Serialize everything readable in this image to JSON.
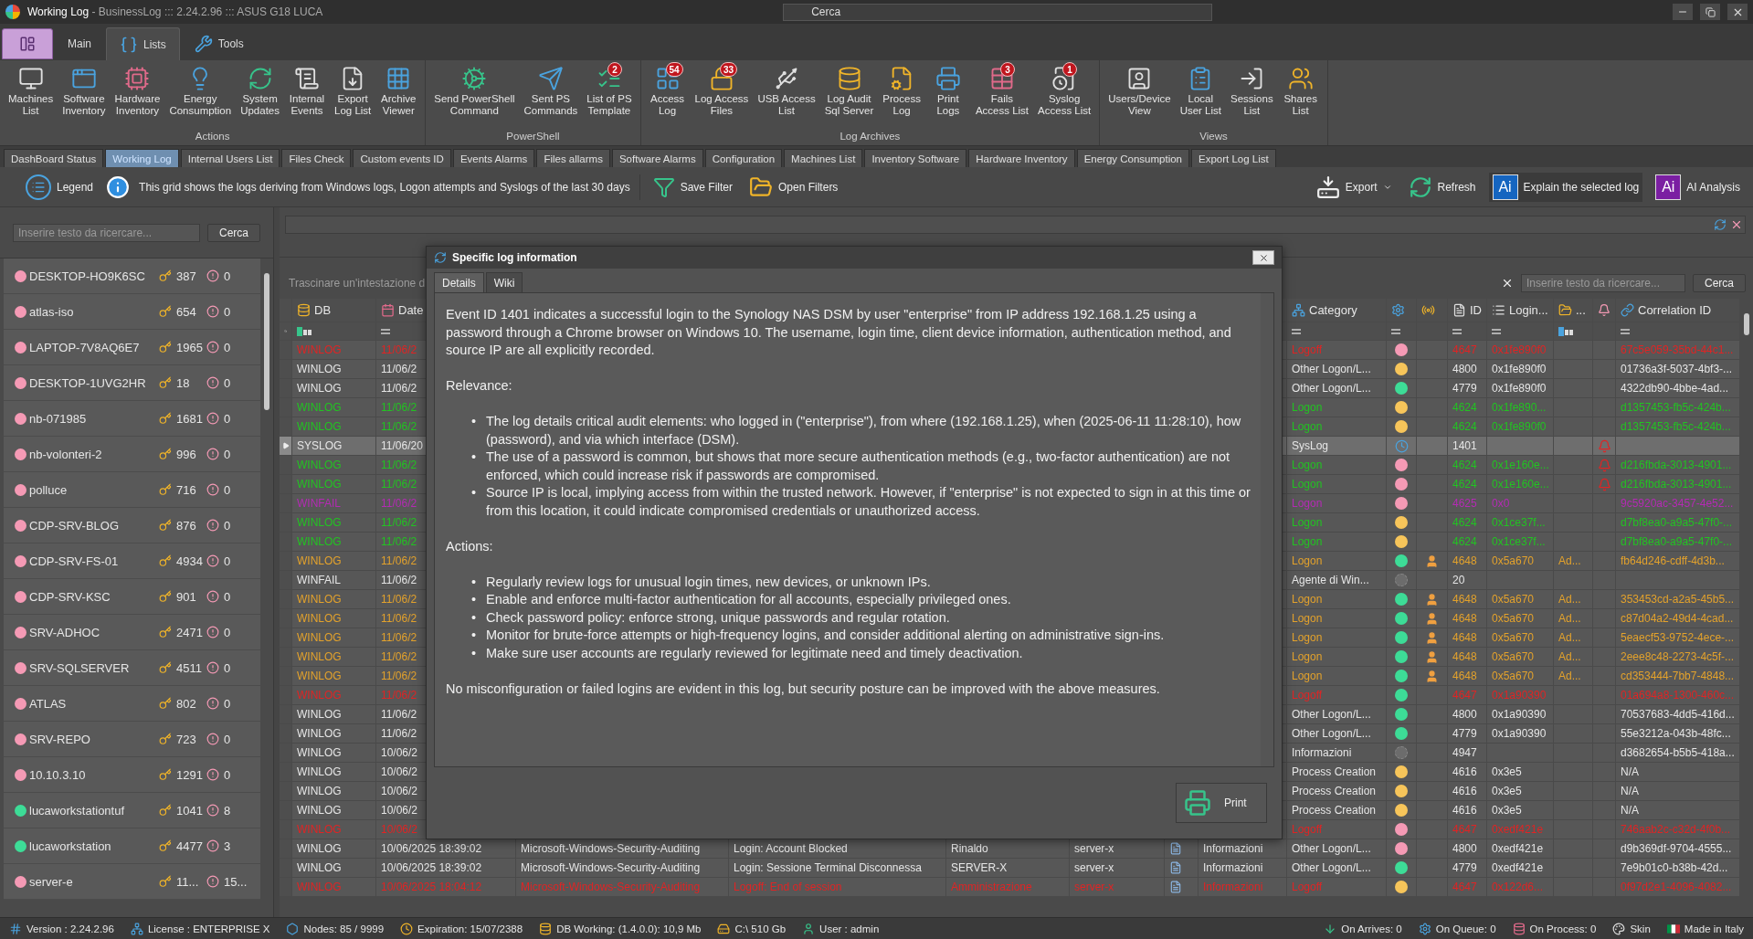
{
  "title_bar": {
    "title": "Working Log",
    "subtitle": "- BusinessLog ::: 2.24.2.96 ::: ASUS G18 LUCA",
    "search_placeholder": "Cerca"
  },
  "ribbon": {
    "tabs": [
      {
        "label": "Main",
        "selected": false
      },
      {
        "label": "Lists",
        "selected": true
      },
      {
        "label": "Tools",
        "selected": false
      }
    ],
    "groups": [
      {
        "label": "Actions",
        "buttons": [
          {
            "lines": [
              "Machines",
              "List"
            ]
          },
          {
            "lines": [
              "Software",
              "Inventory"
            ]
          },
          {
            "lines": [
              "Hardware",
              "Inventory"
            ]
          },
          {
            "lines": [
              "Energy",
              "Consumption"
            ]
          },
          {
            "lines": [
              "System",
              "Updates"
            ]
          },
          {
            "lines": [
              "Internal",
              "Events"
            ]
          },
          {
            "lines": [
              "Export",
              "Log List"
            ]
          },
          {
            "lines": [
              "Archive",
              "Viewer"
            ]
          }
        ]
      },
      {
        "label": "PowerShell",
        "buttons": [
          {
            "lines": [
              "Send PowerShell",
              "Command"
            ]
          },
          {
            "lines": [
              "Sent PS",
              "Commands"
            ]
          },
          {
            "lines": [
              "List of PS",
              "Template"
            ],
            "badge": "2"
          }
        ]
      },
      {
        "label": "Log Archives",
        "buttons": [
          {
            "lines": [
              "Access",
              "Log"
            ],
            "badge": "54"
          },
          {
            "lines": [
              "Log Access",
              "Files"
            ],
            "badge": "33"
          },
          {
            "lines": [
              "USB Access",
              "List"
            ]
          },
          {
            "lines": [
              "Log Audit",
              "Sql Server"
            ]
          },
          {
            "lines": [
              "Process",
              "Log"
            ]
          },
          {
            "lines": [
              "Print",
              "Logs"
            ]
          },
          {
            "lines": [
              "Fails",
              "Access List"
            ],
            "badge": "3"
          },
          {
            "lines": [
              "Syslog",
              "Access List"
            ],
            "badge": "1"
          }
        ]
      },
      {
        "label": "Views",
        "buttons": [
          {
            "lines": [
              "Users/Device",
              "View"
            ]
          },
          {
            "lines": [
              "Local",
              "User List"
            ]
          },
          {
            "lines": [
              "Sessions",
              "List"
            ]
          },
          {
            "lines": [
              "Shares",
              "List"
            ]
          }
        ]
      }
    ]
  },
  "doc_tabs": [
    {
      "label": "DashBoard Status",
      "selected": false
    },
    {
      "label": "Working Log",
      "selected": true
    },
    {
      "label": "Internal Users List",
      "selected": false
    },
    {
      "label": "Files Check",
      "selected": false
    },
    {
      "label": "Custom events ID",
      "selected": false
    },
    {
      "label": "Events Alarms",
      "selected": false
    },
    {
      "label": "Files allarms",
      "selected": false
    },
    {
      "label": "Software Alarms",
      "selected": false
    },
    {
      "label": "Configuration",
      "selected": false
    },
    {
      "label": "Machines List",
      "selected": false
    },
    {
      "label": "Inventory Software",
      "selected": false
    },
    {
      "label": "Hardware Inventory",
      "selected": false
    },
    {
      "label": "Energy Consumption",
      "selected": false
    },
    {
      "label": "Export Log List",
      "selected": false
    }
  ],
  "toolbar": {
    "legend": "Legend",
    "info": "This grid shows the logs deriving from Windows logs, Logon attempts and Syslogs of the last 30 days",
    "save_filter": "Save Filter",
    "open_filters": "Open Filters",
    "export": "Export",
    "refresh": "Refresh",
    "explain": {
      "badge": "Ai",
      "label": "Explain the selected log"
    },
    "ai_analysis": {
      "badge": "Ai",
      "label": "AI Analysis"
    }
  },
  "left_panel": {
    "search_placeholder": "Inserire testo da ricercare...",
    "search_button": "Cerca",
    "machines": [
      {
        "name": "DESKTOP-HO9K6SC",
        "color": "#f59ab5",
        "logins": "387",
        "alerts": "0"
      },
      {
        "name": "atlas-iso",
        "color": "#f59ab5",
        "logins": "654",
        "alerts": "0"
      },
      {
        "name": "LAPTOP-7V8AQ6E7",
        "color": "#f59ab5",
        "logins": "1965",
        "alerts": "0"
      },
      {
        "name": "DESKTOP-1UVG2HR",
        "color": "#f59ab5",
        "logins": "18",
        "alerts": "0"
      },
      {
        "name": "nb-071985",
        "color": "#f59ab5",
        "logins": "1681",
        "alerts": "0"
      },
      {
        "name": "nb-volonteri-2",
        "color": "#f59ab5",
        "logins": "996",
        "alerts": "0"
      },
      {
        "name": "polluce",
        "color": "#f59ab5",
        "logins": "716",
        "alerts": "0"
      },
      {
        "name": "CDP-SRV-BLOG",
        "color": "#f59ab5",
        "logins": "876",
        "alerts": "0"
      },
      {
        "name": "CDP-SRV-FS-01",
        "color": "#f59ab5",
        "logins": "4934",
        "alerts": "0"
      },
      {
        "name": "CDP-SRV-KSC",
        "color": "#f59ab5",
        "logins": "901",
        "alerts": "0"
      },
      {
        "name": "SRV-ADHOC",
        "color": "#f59ab5",
        "logins": "2471",
        "alerts": "0"
      },
      {
        "name": "SRV-SQLSERVER",
        "color": "#f59ab5",
        "logins": "4511",
        "alerts": "0"
      },
      {
        "name": "ATLAS",
        "color": "#f59ab5",
        "logins": "802",
        "alerts": "0"
      },
      {
        "name": "SRV-REPO",
        "color": "#f59ab5",
        "logins": "723",
        "alerts": "0"
      },
      {
        "name": "10.10.3.10",
        "color": "#f59ab5",
        "logins": "1291",
        "alerts": "0"
      },
      {
        "name": "lucaworkstationtuf",
        "color": "#3ddc97",
        "logins": "1041",
        "alerts": "8"
      },
      {
        "name": "lucaworkstation",
        "color": "#3ddc97",
        "logins": "4477",
        "alerts": "3"
      },
      {
        "name": "server-e",
        "color": "#f59ab5",
        "logins": "11...",
        "alerts": "15..."
      }
    ]
  },
  "grid": {
    "group_hint": "Trascinare un'intestazione d",
    "search_placeholder": "Inserire testo da ricercare...",
    "search_button": "Cerca",
    "columns": [
      {
        "label": "DB"
      },
      {
        "label": "Date"
      },
      {
        "label": "Category"
      },
      {
        "label": "ID"
      },
      {
        "label": "Login..."
      },
      {
        "label": "..."
      },
      {
        "label": "Correlation ID"
      }
    ],
    "rows": [
      {
        "selected": false,
        "color": "#e02424",
        "db": "WINLOG",
        "date": "11/06/2",
        "category": "Logoff",
        "status": {
          "kind": "dot",
          "color": "#f59ab5"
        },
        "user_icon": false,
        "id": "4647",
        "login": "0x1fe890f0",
        "alarm": false,
        "correlation": "67c5e059-35bd-44c1..."
      },
      {
        "selected": false,
        "color": "#e6e6e6",
        "db": "WINLOG",
        "date": "11/06/2",
        "category": "Other Logon/L...",
        "status": {
          "kind": "dot",
          "color": "#f7c55a"
        },
        "user_icon": false,
        "id": "4800",
        "login": "0x1fe890f0",
        "alarm": false,
        "correlation": "01736a3f-5037-4bf3-..."
      },
      {
        "selected": false,
        "color": "#e6e6e6",
        "db": "WINLOG",
        "date": "11/06/2",
        "category": "Other Logon/L...",
        "status": {
          "kind": "dot",
          "color": "#3ddc97"
        },
        "user_icon": false,
        "id": "4779",
        "login": "0x1fe890f0",
        "alarm": false,
        "correlation": "4322db90-4bbe-4ad..."
      },
      {
        "selected": false,
        "color": "#22c322",
        "db": "WINLOG",
        "date": "11/06/2",
        "category": "Logon",
        "status": {
          "kind": "dot",
          "color": "#f7c55a"
        },
        "user_icon": false,
        "id": "4624",
        "login": "0x1fe890...",
        "alarm": false,
        "correlation": "d1357453-fb5c-424b..."
      },
      {
        "selected": false,
        "color": "#22c322",
        "db": "WINLOG",
        "date": "11/06/2",
        "category": "Logon",
        "status": {
          "kind": "dot",
          "color": "#f7c55a"
        },
        "user_icon": false,
        "id": "4624",
        "login": "0x1fe890f0",
        "alarm": false,
        "correlation": "d1357453-fb5c-424b..."
      },
      {
        "selected": true,
        "color": "#e6e6e6",
        "db": "SYSLOG",
        "date": "11/06/20",
        "category": "SysLog",
        "status": {
          "kind": "clock"
        },
        "user_icon": false,
        "id": "1401",
        "alarm": true
      },
      {
        "selected": false,
        "color": "#22c322",
        "db": "WINLOG",
        "date": "11/06/2",
        "category": "Logon",
        "status": {
          "kind": "dot",
          "color": "#f59ab5"
        },
        "user_icon": false,
        "id": "4624",
        "login": "0x1e160e...",
        "alarm": true,
        "correlation": "d216fbda-3013-4901..."
      },
      {
        "selected": false,
        "color": "#22c322",
        "db": "WINLOG",
        "date": "11/06/2",
        "category": "Logon",
        "status": {
          "kind": "dot",
          "color": "#f59ab5"
        },
        "user_icon": false,
        "id": "4624",
        "login": "0x1e160e...",
        "alarm": true,
        "correlation": "d216fbda-3013-4901..."
      },
      {
        "selected": false,
        "color": "#b52ab5",
        "db": "WINFAIL",
        "date": "11/06/2",
        "category": "Logon",
        "status": {
          "kind": "dot",
          "color": "#f59ab5"
        },
        "user_icon": false,
        "id": "4625",
        "login": "0x0",
        "alarm": false,
        "correlation": "9c5920ac-3457-4e52..."
      },
      {
        "selected": false,
        "color": "#22c322",
        "db": "WINLOG",
        "date": "11/06/2",
        "category": "Logon",
        "status": {
          "kind": "dot",
          "color": "#f7c55a"
        },
        "user_icon": false,
        "id": "4624",
        "login": "0x1ce37f...",
        "alarm": false,
        "correlation": "d7bf8ea0-a9a5-47f0-..."
      },
      {
        "selected": false,
        "color": "#22c322",
        "db": "WINLOG",
        "date": "11/06/2",
        "category": "Logon",
        "status": {
          "kind": "dot",
          "color": "#f7c55a"
        },
        "user_icon": false,
        "id": "4624",
        "login": "0x1ce37f...",
        "alarm": false,
        "correlation": "d7bf8ea0-a9a5-47f0-..."
      },
      {
        "selected": false,
        "color": "#e3a22c",
        "db": "WINLOG",
        "date": "11/06/2",
        "category": "Logon",
        "status": {
          "kind": "dot",
          "color": "#3ddc97"
        },
        "user_icon": true,
        "id": "4648",
        "login": "0x5a670",
        "col_3": "Ad...",
        "alarm": false,
        "correlation": "fb64d246-cdff-4d3b..."
      },
      {
        "selected": false,
        "color": "#e6e6e6",
        "db": "WINFAIL",
        "date": "11/06/2",
        "category": "Agente di Win...",
        "status": {
          "kind": "empty"
        },
        "user_icon": false,
        "id": "20",
        "alarm": false
      },
      {
        "selected": false,
        "color": "#e3a22c",
        "db": "WINLOG",
        "date": "11/06/2",
        "category": "Logon",
        "status": {
          "kind": "dot",
          "color": "#3ddc97"
        },
        "user_icon": true,
        "id": "4648",
        "login": "0x5a670",
        "col_3": "Ad...",
        "alarm": false,
        "correlation": "353453cd-a2a5-45b5..."
      },
      {
        "selected": false,
        "color": "#e3a22c",
        "db": "WINLOG",
        "date": "11/06/2",
        "category": "Logon",
        "status": {
          "kind": "dot",
          "color": "#3ddc97"
        },
        "user_icon": true,
        "id": "4648",
        "login": "0x5a670",
        "col_3": "Ad...",
        "alarm": false,
        "correlation": "c87d04a2-49d4-4cad..."
      },
      {
        "selected": false,
        "color": "#e3a22c",
        "db": "WINLOG",
        "date": "11/06/2",
        "category": "Logon",
        "status": {
          "kind": "dot",
          "color": "#3ddc97"
        },
        "user_icon": true,
        "id": "4648",
        "login": "0x5a670",
        "col_3": "Ad...",
        "alarm": false,
        "correlation": "5eaecf53-9752-4ece-..."
      },
      {
        "selected": false,
        "color": "#e3a22c",
        "db": "WINLOG",
        "date": "11/06/2",
        "category": "Logon",
        "status": {
          "kind": "dot",
          "color": "#3ddc97"
        },
        "user_icon": true,
        "id": "4648",
        "login": "0x5a670",
        "col_3": "Ad...",
        "alarm": false,
        "correlation": "2eee8c48-2273-4c5f-..."
      },
      {
        "selected": false,
        "color": "#e3a22c",
        "db": "WINLOG",
        "date": "11/06/2",
        "category": "Logon",
        "status": {
          "kind": "dot",
          "color": "#3ddc97"
        },
        "user_icon": true,
        "id": "4648",
        "login": "0x5a670",
        "col_3": "Ad...",
        "alarm": false,
        "correlation": "cd353444-7bb7-4848..."
      },
      {
        "selected": false,
        "color": "#e02424",
        "db": "WINLOG",
        "date": "11/06/2",
        "category": "Logoff",
        "status": {
          "kind": "dot",
          "color": "#3ddc97"
        },
        "user_icon": false,
        "id": "4647",
        "login": "0x1a90390",
        "alarm": false,
        "correlation": "01a694a8-1300-460c..."
      },
      {
        "selected": false,
        "color": "#e6e6e6",
        "db": "WINLOG",
        "date": "11/06/2",
        "category": "Other Logon/L...",
        "status": {
          "kind": "dot",
          "color": "#3ddc97"
        },
        "user_icon": false,
        "id": "4800",
        "login": "0x1a90390",
        "alarm": false,
        "correlation": "70537683-4dd5-416d..."
      },
      {
        "selected": false,
        "color": "#e6e6e6",
        "db": "WINLOG",
        "date": "11/06/2",
        "category": "Other Logon/L...",
        "status": {
          "kind": "dot",
          "color": "#3ddc97"
        },
        "user_icon": false,
        "id": "4779",
        "login": "0x1a90390",
        "alarm": false,
        "correlation": "55e3212a-043b-48fc..."
      },
      {
        "selected": false,
        "color": "#e6e6e6",
        "db": "WINLOG",
        "date": "10/06/2",
        "category": "Informazioni",
        "status": {
          "kind": "empty"
        },
        "user_icon": false,
        "id": "4947",
        "alarm": false,
        "correlation": "d3682654-b5b5-418a..."
      },
      {
        "selected": false,
        "color": "#e6e6e6",
        "db": "WINLOG",
        "date": "10/06/2",
        "category": "Process Creation",
        "status": {
          "kind": "dot",
          "color": "#f7c55a"
        },
        "user_icon": false,
        "id": "4616",
        "login": "0x3e5",
        "alarm": false,
        "correlation": "N/A"
      },
      {
        "selected": false,
        "color": "#e6e6e6",
        "db": "WINLOG",
        "date": "10/06/2",
        "category": "Process Creation",
        "status": {
          "kind": "dot",
          "color": "#f7c55a"
        },
        "user_icon": false,
        "id": "4616",
        "login": "0x3e5",
        "alarm": false,
        "correlation": "N/A"
      },
      {
        "selected": false,
        "color": "#e6e6e6",
        "db": "WINLOG",
        "date": "10/06/2",
        "category": "Process Creation",
        "status": {
          "kind": "dot",
          "color": "#f7c55a"
        },
        "user_icon": false,
        "id": "4616",
        "login": "0x3e5",
        "alarm": false,
        "correlation": "N/A"
      },
      {
        "selected": false,
        "color": "#e02424",
        "db": "WINLOG",
        "date": "10/06/2",
        "category": "Logoff",
        "status": {
          "kind": "dot",
          "color": "#f59ab5"
        },
        "user_icon": false,
        "id": "4647",
        "login": "0xedf421e",
        "alarm": false,
        "correlation": "746aab2c-c32d-4f0b..."
      },
      {
        "selected": false,
        "color": "#e6e6e6",
        "db": "WINLOG",
        "date": "10/06/2025 18:39:02",
        "source": "Microsoft-Windows-Security-Auditing",
        "description": "Login: Account Blocked",
        "user": "Rinaldo",
        "computer": "server-x",
        "level": "Informazioni",
        "category": "Other Logon/L...",
        "status": {
          "kind": "dot",
          "color": "#f59ab5"
        },
        "user_icon": false,
        "id": "4800",
        "login": "0xedf421e",
        "alarm": false,
        "correlation": "d9b369df-9704-4555..."
      },
      {
        "selected": false,
        "color": "#e6e6e6",
        "db": "WINLOG",
        "date": "10/06/2025 18:39:02",
        "source": "Microsoft-Windows-Security-Auditing",
        "description": "Login: Sessione Terminal Disconnessa",
        "user": "SERVER-X",
        "computer": "server-x",
        "level": "Informazioni",
        "category": "Other Logon/L...",
        "status": {
          "kind": "dot",
          "color": "#3ddc97"
        },
        "user_icon": false,
        "id": "4779",
        "login": "0xedf421e",
        "alarm": false,
        "correlation": "7e9b01c0-b38b-42d..."
      },
      {
        "selected": false,
        "color": "#e02424",
        "db": "WINLOG",
        "date": "10/06/2025 18:04:12",
        "source": "Microsoft-Windows-Security-Auditing",
        "description": "Logoff: End of session",
        "user": "Amministrazione",
        "computer": "server-x",
        "level": "Informazioni",
        "category": "Logoff",
        "status": {
          "kind": "dot",
          "color": "#f7c55a"
        },
        "user_icon": false,
        "id": "4647",
        "login": "0x122d6...",
        "alarm": false,
        "correlation": "0f97d2e1-4096-4082..."
      }
    ]
  },
  "dialog": {
    "title": "Specific log information",
    "tabs": [
      {
        "label": "Details",
        "selected": true
      },
      {
        "label": "Wiki",
        "selected": false
      }
    ],
    "blocks": [
      {
        "kind": "paragraph",
        "text": "Event ID 1401 indicates a successful login to the Synology NAS DSM by user \"enterprise\" from IP address 192.168.1.25 using a password through a Chrome browser on Windows 10. The username, login time, client device information, authentication method, and source IP are all explicitly recorded."
      },
      {
        "kind": "paragraph",
        "text": "Relevance:"
      },
      {
        "kind": "list",
        "marker": "•",
        "items": [
          "The log details critical audit elements: who logged in (\"enterprise\"), from where (192.168.1.25), when (2025-06-11 11:28:10), how (password), and via which interface (DSM).",
          "The use of a password is common, but shows that more secure authentication methods (e.g., two-factor authentication) are not enforced, which could increase risk if passwords are compromised.",
          "Source IP is local, implying access from within the trusted network. However, if \"enterprise\" is not expected to sign in at this time or from this location, it could indicate compromised credentials or unauthorized access."
        ]
      },
      {
        "kind": "paragraph",
        "text": "Actions:"
      },
      {
        "kind": "list",
        "marker": "•",
        "items": [
          "Regularly review logs for unusual login times, new devices, or unknown IPs.",
          "Enable and enforce multi-factor authentication for all accounts, especially privileged ones.",
          "Check password policy: enforce strong, unique passwords and regular rotation.",
          "Monitor for brute-force attempts or high-frequency logins, and consider additional alerting on administrative sign-ins.",
          "Make sure user accounts are regularly reviewed for legitimate need and timely deactivation."
        ]
      },
      {
        "kind": "paragraph",
        "text": "No misconfiguration or failed logins are evident in this log, but security posture can be improved with the above measures."
      }
    ],
    "print": "Print"
  },
  "status_bar": {
    "left": [
      "Version : 2.24.2.96",
      "License : ENTERPRISE X",
      "Nodes: 85 / 9999",
      "Expiration: 15/07/2388",
      "DB Working: (1.4.0.0): 10,9 Mb",
      "C:\\ 510 Gb",
      "User : admin"
    ],
    "right": [
      "On Arrives: 0",
      "On Queue: 0",
      "On Process: 0",
      "Skin",
      "Made in Italy"
    ]
  }
}
